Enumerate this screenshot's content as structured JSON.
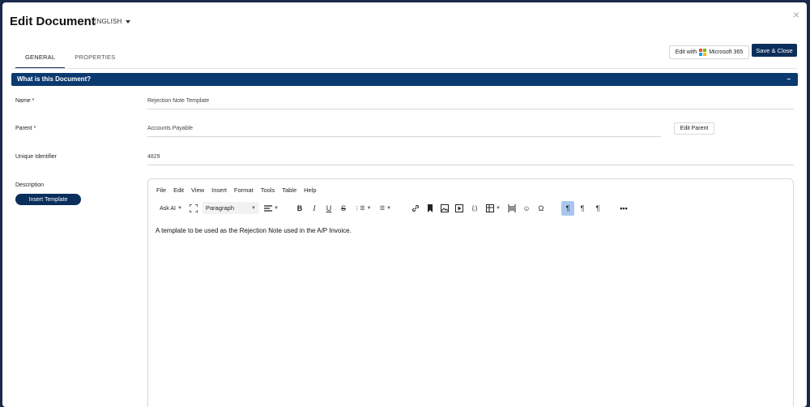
{
  "header": {
    "title": "Edit Document",
    "language": "ENGLISH",
    "close_label": "×"
  },
  "actions": {
    "edit_with_label": "Edit with",
    "ms365_label": "Microsoft 365",
    "save_close_label": "Save & Close"
  },
  "tabs": [
    {
      "label": "GENERAL",
      "active": true
    },
    {
      "label": "PROPERTIES",
      "active": false
    }
  ],
  "section": {
    "title": "What is this Document?",
    "collapse_label": "−"
  },
  "form": {
    "name_label": "Name *",
    "name_value": "Rejection Note Template",
    "parent_label": "Parent  *",
    "parent_value": "Accounts Payable",
    "edit_parent_label": "Edit Parent",
    "uid_label": "Unique Identifier",
    "uid_value": "4829",
    "description_label": "Description",
    "insert_template_label": "Insert Template"
  },
  "editor": {
    "menu": [
      "File",
      "Edit",
      "View",
      "Insert",
      "Format",
      "Tools",
      "Table",
      "Help"
    ],
    "ask_ai_label": "Ask AI",
    "paragraph_value": "Paragraph",
    "content": "A template to be used as the Rejection Note used in the A/P Invoice."
  },
  "colors": {
    "primary": "#0b2f5b",
    "section_bar": "#0b3a70",
    "active_tool": "#a9c7ee"
  },
  "icons": [
    "close-icon",
    "microsoft-logo-icon",
    "fullscreen-icon",
    "align-icon",
    "bold-icon",
    "italic-icon",
    "underline-icon",
    "strikethrough-icon",
    "numbered-list-icon",
    "bullet-list-icon",
    "link-icon",
    "bookmark-icon",
    "image-icon",
    "media-icon",
    "code-icon",
    "table-icon",
    "page-break-icon",
    "emoji-icon",
    "special-char-icon",
    "ltr-icon",
    "rtl-icon",
    "show-blocks-icon",
    "more-icon"
  ]
}
